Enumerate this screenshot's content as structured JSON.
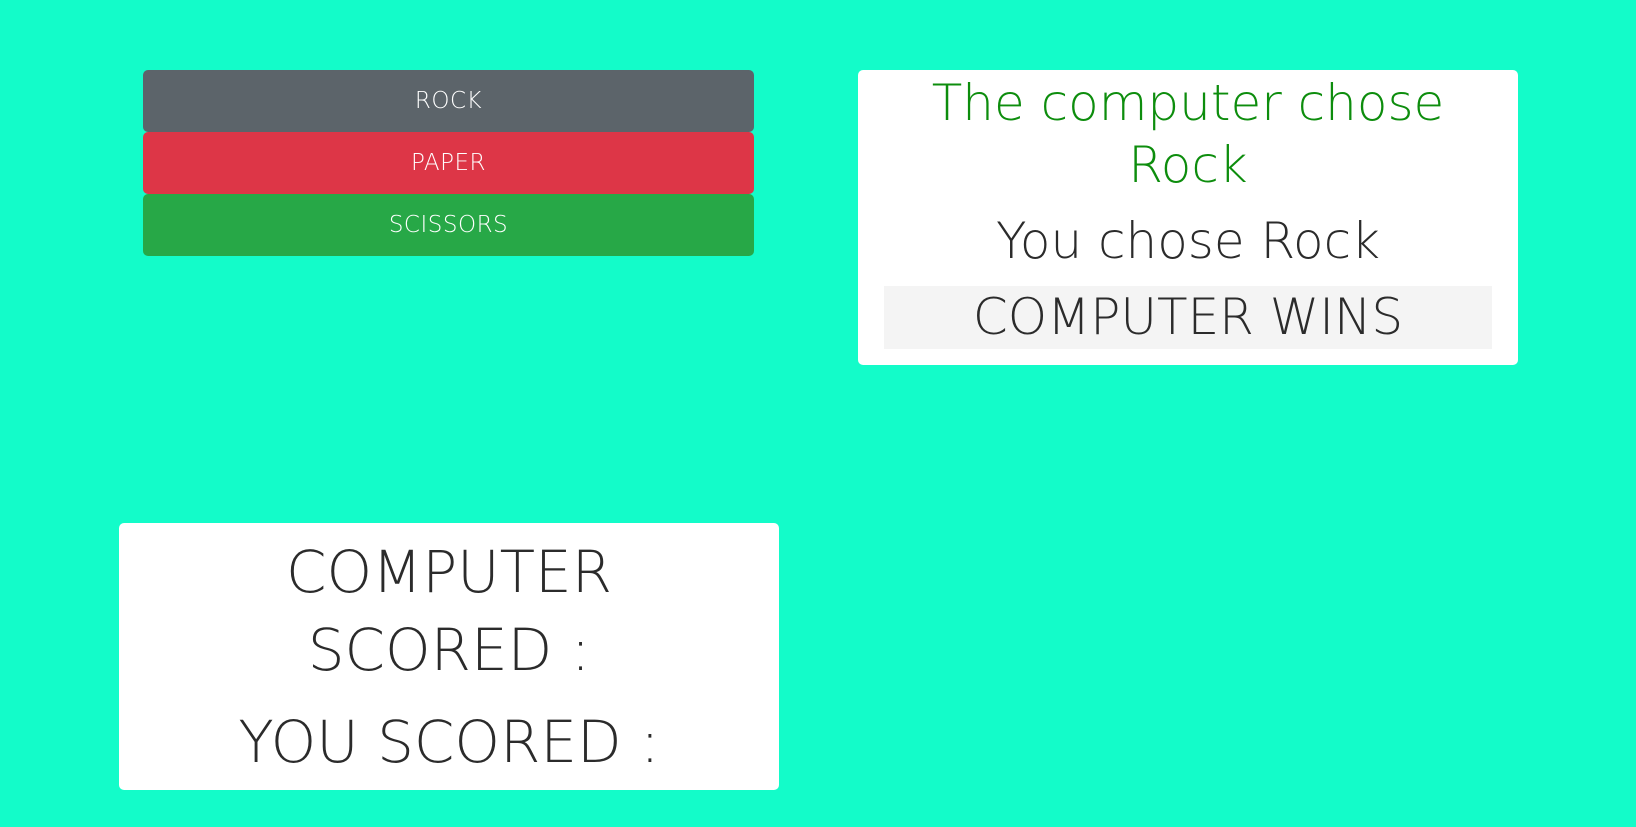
{
  "choices": {
    "rock_label": "ROCK",
    "paper_label": "PAPER",
    "scissors_label": "SCISSORS"
  },
  "result": {
    "computer_choice_text": "The computer chose Rock",
    "user_choice_text": "You chose Rock",
    "verdict_text": "COMPUTER WINS"
  },
  "score": {
    "computer_score_text": "COMPUTER SCORED :",
    "user_score_text": "YOU SCORED :"
  },
  "colors": {
    "background": "#13fcc9",
    "rock_button": "#5c646a",
    "paper_button": "#dd3647",
    "scissors_button": "#27a847",
    "computer_choice_text": "#0d8d0d"
  }
}
